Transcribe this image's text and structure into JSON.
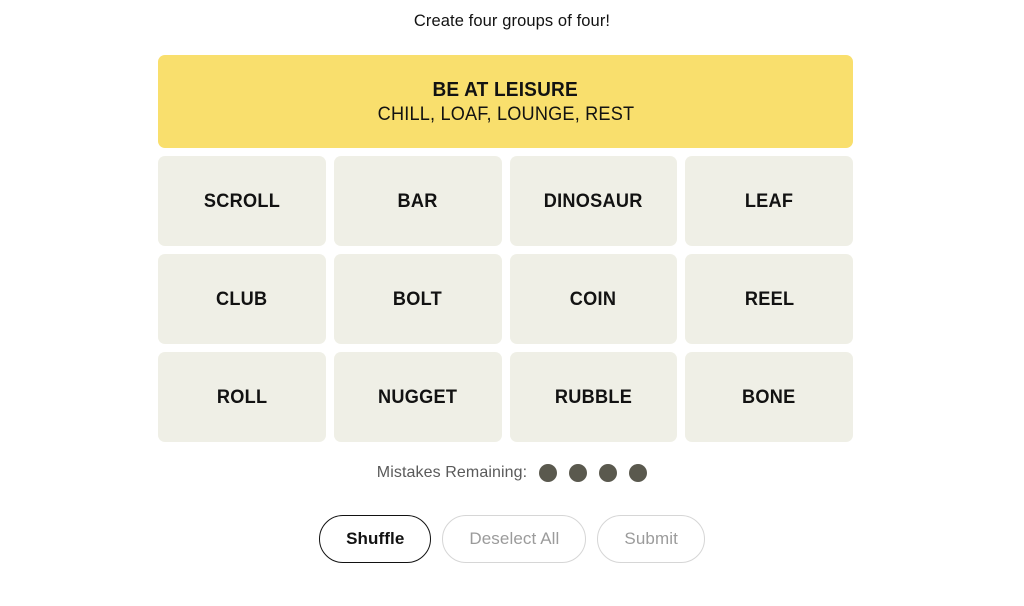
{
  "header": {
    "instruction": "Create four groups of four!"
  },
  "board": {
    "solved_groups": [
      {
        "title": "BE AT LEISURE",
        "members": "CHILL, LOAF, LOUNGE, REST",
        "color": "#f9df6d"
      }
    ],
    "tile_color": "#efefe6",
    "tiles": [
      {
        "label": "SCROLL"
      },
      {
        "label": "BAR"
      },
      {
        "label": "DINOSAUR"
      },
      {
        "label": "LEAF"
      },
      {
        "label": "CLUB"
      },
      {
        "label": "BOLT"
      },
      {
        "label": "COIN"
      },
      {
        "label": "REEL"
      },
      {
        "label": "ROLL"
      },
      {
        "label": "NUGGET"
      },
      {
        "label": "RUBBLE"
      },
      {
        "label": "BONE"
      }
    ]
  },
  "mistakes": {
    "label": "Mistakes Remaining:",
    "remaining": 4,
    "dot_color": "#5a594e"
  },
  "buttons": [
    {
      "label": "Shuffle",
      "state": "enabled"
    },
    {
      "label": "Deselect All",
      "state": "disabled"
    },
    {
      "label": "Submit",
      "state": "disabled"
    }
  ]
}
